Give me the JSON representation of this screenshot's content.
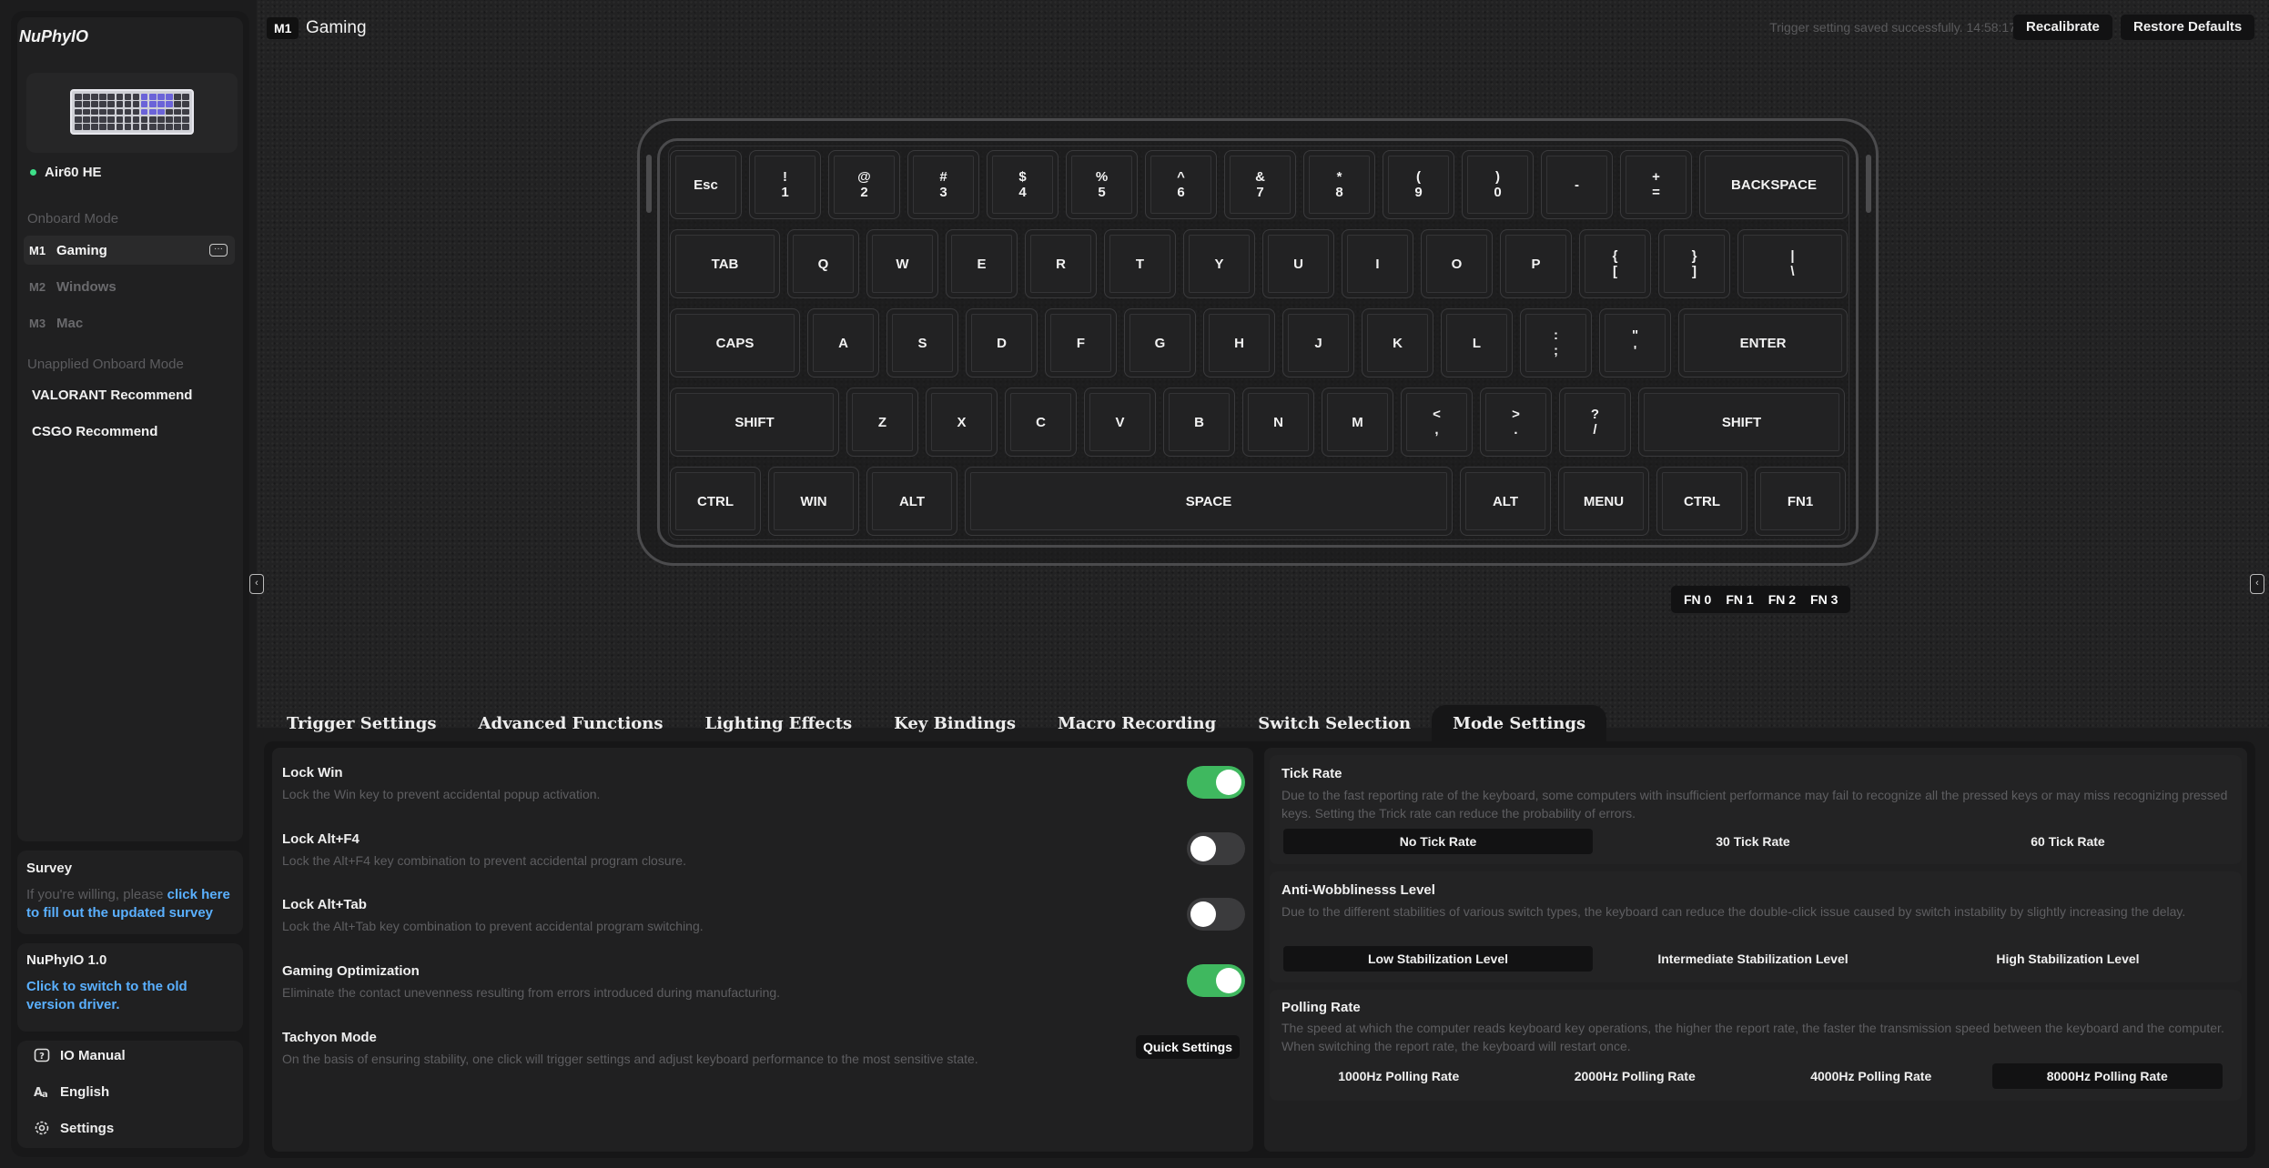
{
  "app": {
    "brand": "NuPhyIO"
  },
  "device": {
    "name": "Air60 HE"
  },
  "sidebar": {
    "onboard_heading": "Onboard Mode",
    "modes": [
      {
        "tag": "M1",
        "name": "Gaming"
      },
      {
        "tag": "M2",
        "name": "Windows"
      },
      {
        "tag": "M3",
        "name": "Mac"
      }
    ],
    "more_glyph": "···",
    "unapplied_heading": "Unapplied Onboard Mode",
    "unapplied": [
      "VALORANT Recommend",
      "CSGO Recommend"
    ],
    "survey": {
      "title": "Survey",
      "text": "If you're willing, please ",
      "link": "click here to fill out the updated survey"
    },
    "version": {
      "title": "NuPhyIO 1.0",
      "link": "Click to switch to the old version driver."
    },
    "links": {
      "manual": "IO Manual",
      "language": "English",
      "settings": "Settings"
    }
  },
  "header": {
    "mode_tag": "M1",
    "mode_name": "Gaming",
    "status": "Trigger setting saved successfully. 14:58:17",
    "recalibrate": "Recalibrate",
    "restore": "Restore Defaults"
  },
  "keyboard": {
    "rows": [
      [
        "Esc",
        "!\n1",
        "@\n2",
        "#\n3",
        "$\n4",
        "%\n5",
        "^\n6",
        "&\n7",
        "*\n8",
        "(\n9",
        ")\n0",
        "-",
        "+\n=",
        "BACKSPACE"
      ],
      [
        "TAB",
        "Q",
        "W",
        "E",
        "R",
        "T",
        "Y",
        "U",
        "I",
        "O",
        "P",
        "{\n[",
        "}\n]",
        "|\n\\"
      ],
      [
        "CAPS",
        "A",
        "S",
        "D",
        "F",
        "G",
        "H",
        "J",
        "K",
        "L",
        ":\n;",
        "\"\n'",
        "ENTER"
      ],
      [
        "SHIFT",
        "Z",
        "X",
        "C",
        "V",
        "B",
        "N",
        "M",
        "<\n,",
        ">\n.",
        "?\n/",
        "SHIFT"
      ],
      [
        "CTRL",
        "WIN",
        "ALT",
        "SPACE",
        "ALT",
        "MENU",
        "CTRL",
        "FN1"
      ]
    ],
    "fn_layers": [
      "FN 0",
      "FN 1",
      "FN 2",
      "FN 3"
    ]
  },
  "tabs": [
    {
      "label": "Trigger Settings",
      "active": false
    },
    {
      "label": "Advanced Functions",
      "active": false
    },
    {
      "label": "Lighting Effects",
      "active": false
    },
    {
      "label": "Key Bindings",
      "active": false
    },
    {
      "label": "Macro Recording",
      "active": false
    },
    {
      "label": "Switch Selection",
      "active": false
    },
    {
      "label": "Mode Settings",
      "active": true
    }
  ],
  "mode_settings": {
    "options": [
      {
        "title": "Lock Win",
        "desc": "Lock the Win key to prevent accidental popup activation.",
        "on": true
      },
      {
        "title": "Lock Alt+F4",
        "desc": "Lock the Alt+F4 key combination to prevent accidental program closure.",
        "on": false
      },
      {
        "title": "Lock Alt+Tab",
        "desc": "Lock the Alt+Tab key combination to prevent accidental program switching.",
        "on": false
      },
      {
        "title": "Gaming Optimization",
        "desc": "Eliminate the contact unevenness resulting from errors introduced during manufacturing.",
        "on": true
      }
    ],
    "tachyon": {
      "title": "Tachyon Mode",
      "desc": "On the basis of ensuring stability, one click will trigger settings and adjust keyboard performance to the most sensitive state.",
      "button": "Quick Settings"
    },
    "tick_rate": {
      "title": "Tick Rate",
      "desc": "Due to the fast reporting rate of the keyboard, some computers with insufficient performance may fail to recognize all the pressed keys or may miss recognizing pressed keys. Setting the Trick rate can reduce the probability of errors.",
      "options": [
        "No Tick Rate",
        "30 Tick Rate",
        "60 Tick Rate"
      ],
      "selected": "No Tick Rate"
    },
    "anti_wobble": {
      "title": "Anti-Wobblinesss Level",
      "desc": "Due to the different stabilities of various switch types, the keyboard can reduce the double-click issue caused by switch instability by slightly increasing the delay.",
      "options": [
        "Low Stabilization Level",
        "Intermediate Stabilization Level",
        "High Stabilization Level"
      ],
      "selected": "Low Stabilization Level"
    },
    "polling": {
      "title": "Polling Rate",
      "desc": "The speed at which the computer reads keyboard key operations, the higher the report rate, the faster the transmission speed between the keyboard and the computer. When switching the report rate, the keyboard will restart once.",
      "options": [
        "1000Hz Polling Rate",
        "2000Hz Polling Rate",
        "4000Hz Polling Rate",
        "8000Hz Polling Rate"
      ],
      "selected": "8000Hz Polling Rate"
    }
  },
  "colors": {
    "accent_green": "#3fb85f",
    "link_blue": "#5ab0ff",
    "status_dot": "#3ee089"
  }
}
